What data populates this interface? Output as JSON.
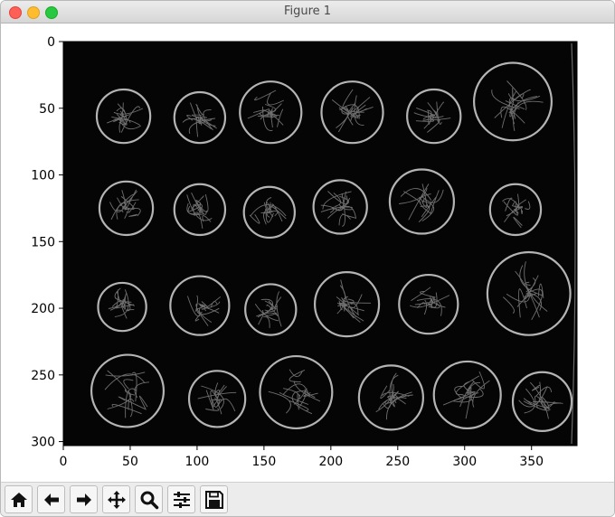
{
  "window": {
    "title": "Figure 1"
  },
  "toolbar": {
    "buttons": [
      {
        "icon": "home-icon",
        "tooltip": ""
      },
      {
        "icon": "arrow-left-icon",
        "tooltip": ""
      },
      {
        "icon": "arrow-right-icon",
        "tooltip": ""
      },
      {
        "icon": "pan-move-icon",
        "tooltip": ""
      },
      {
        "icon": "zoom-magnifier-icon",
        "tooltip": ""
      },
      {
        "icon": "configure-subplots-icon",
        "tooltip": ""
      },
      {
        "icon": "save-floppy-icon",
        "tooltip": ""
      }
    ]
  },
  "chart_data": {
    "type": "image",
    "image_description": "edge-filtered grayscale image of 24 coins arranged in 4 rows",
    "xlim": [
      0,
      384
    ],
    "ylim_inverted": [
      303,
      0
    ],
    "xticks": [
      0,
      50,
      100,
      150,
      200,
      250,
      300,
      350
    ],
    "yticks": [
      0,
      50,
      100,
      150,
      200,
      250,
      300
    ],
    "coins": [
      {
        "x": 45,
        "y": 56,
        "r": 20
      },
      {
        "x": 102,
        "y": 57,
        "r": 19
      },
      {
        "x": 155,
        "y": 53,
        "r": 23
      },
      {
        "x": 216,
        "y": 53,
        "r": 23
      },
      {
        "x": 277,
        "y": 56,
        "r": 20
      },
      {
        "x": 336,
        "y": 45,
        "r": 29
      },
      {
        "x": 47,
        "y": 125,
        "r": 20
      },
      {
        "x": 102,
        "y": 126,
        "r": 19
      },
      {
        "x": 154,
        "y": 128,
        "r": 19
      },
      {
        "x": 207,
        "y": 124,
        "r": 20
      },
      {
        "x": 268,
        "y": 120,
        "r": 24
      },
      {
        "x": 338,
        "y": 126,
        "r": 19
      },
      {
        "x": 44,
        "y": 199,
        "r": 18
      },
      {
        "x": 102,
        "y": 198,
        "r": 22
      },
      {
        "x": 155,
        "y": 201,
        "r": 19
      },
      {
        "x": 212,
        "y": 197,
        "r": 24
      },
      {
        "x": 273,
        "y": 197,
        "r": 22
      },
      {
        "x": 348,
        "y": 189,
        "r": 31
      },
      {
        "x": 48,
        "y": 262,
        "r": 27
      },
      {
        "x": 115,
        "y": 268,
        "r": 21
      },
      {
        "x": 174,
        "y": 263,
        "r": 27
      },
      {
        "x": 245,
        "y": 267,
        "r": 24
      },
      {
        "x": 302,
        "y": 265,
        "r": 25
      },
      {
        "x": 358,
        "y": 270,
        "r": 22
      }
    ]
  }
}
